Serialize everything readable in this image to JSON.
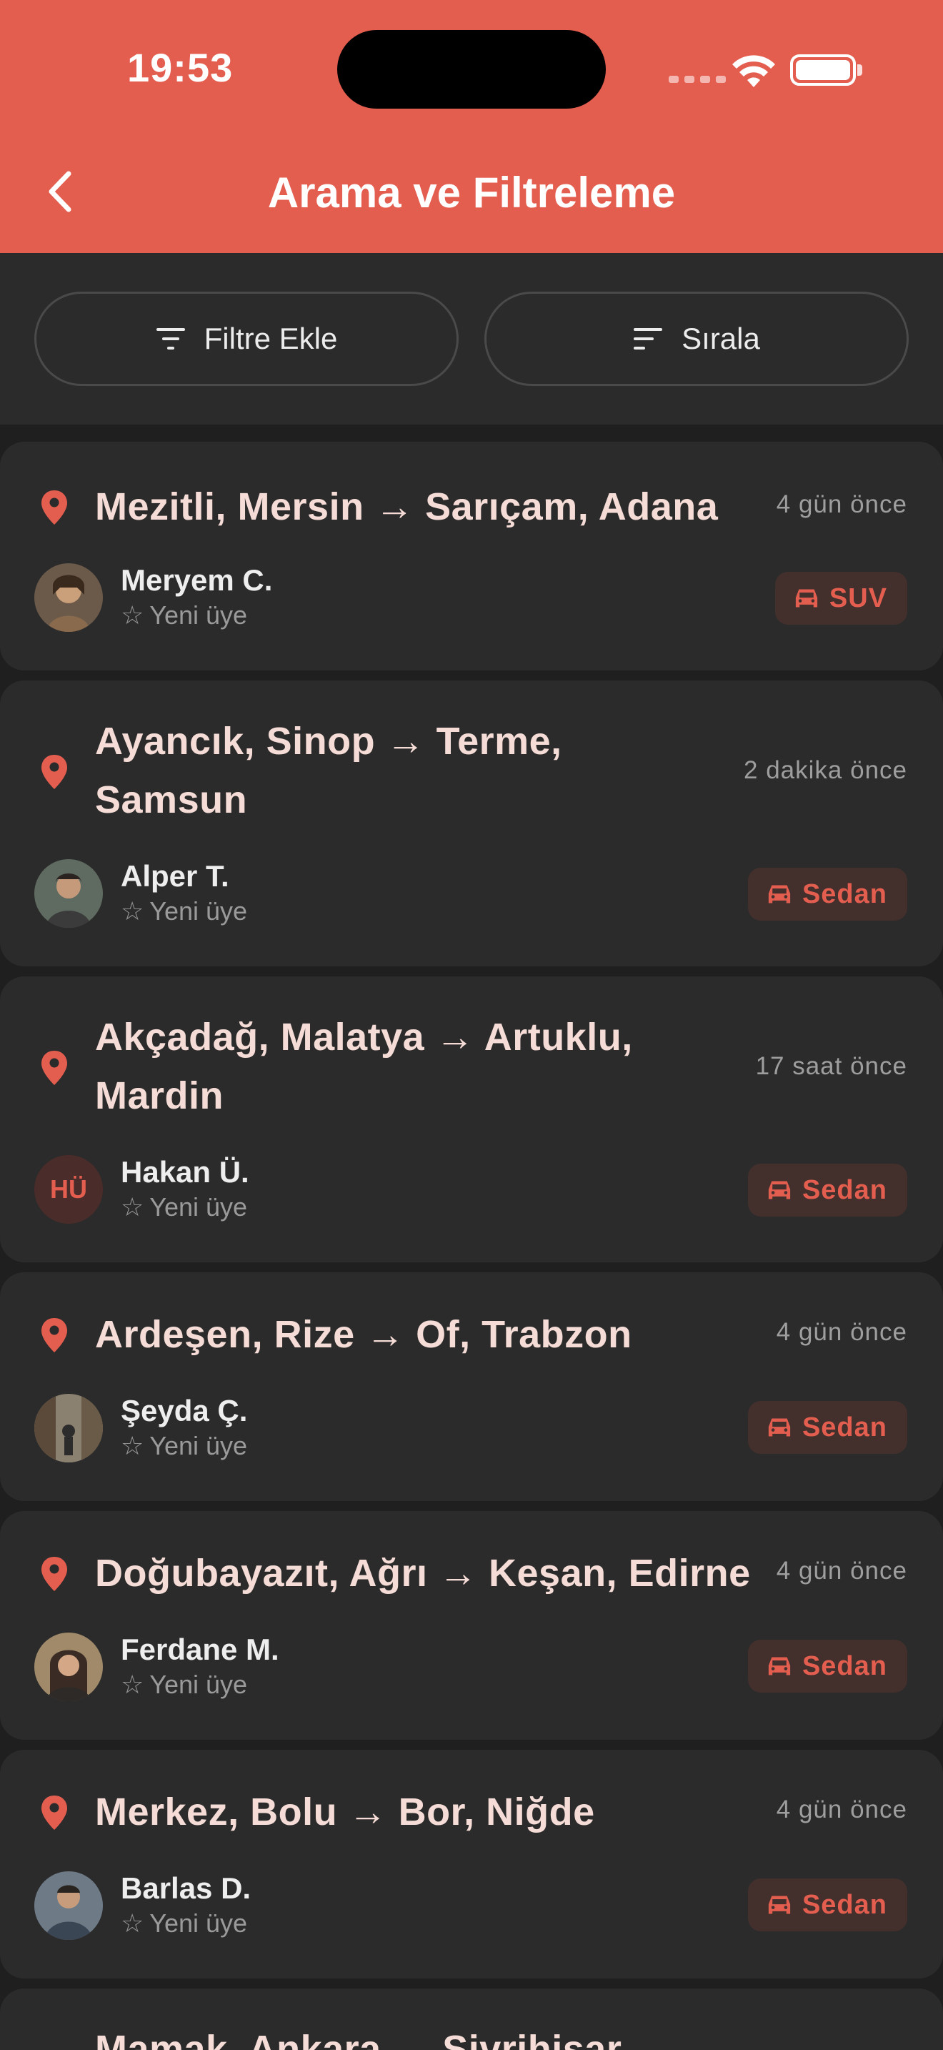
{
  "status_bar": {
    "time": "19:53"
  },
  "header": {
    "title": "Arama ve Filtreleme"
  },
  "toolbar": {
    "filter_label": "Filtre Ekle",
    "sort_label": "Sırala"
  },
  "theme": {
    "accent": "#e45e50",
    "card_bg": "#2b2b2b",
    "page_bg": "#1f1f1f"
  },
  "rides": [
    {
      "route": "Mezitli, Mersin → Sarıçam, Adana",
      "time": "4 gün önce",
      "user": "Meryem C.",
      "rating": "Yeni üye",
      "vehicle": "SUV",
      "avatar": "photo"
    },
    {
      "route": "Ayancık, Sinop → Terme, Samsun",
      "time": "2 dakika önce",
      "user": "Alper T.",
      "rating": "Yeni üye",
      "vehicle": "Sedan",
      "avatar": "photo"
    },
    {
      "route": "Akçadağ, Malatya → Artuklu, Mardin",
      "time": "17 saat önce",
      "user": "Hakan Ü.",
      "rating": "Yeni üye",
      "vehicle": "Sedan",
      "avatar_initials": "HÜ"
    },
    {
      "route": "Ardeşen, Rize → Of, Trabzon",
      "time": "4 gün önce",
      "user": "Şeyda Ç.",
      "rating": "Yeni üye",
      "vehicle": "Sedan",
      "avatar": "photo"
    },
    {
      "route": "Doğubayazıt, Ağrı → Keşan, Edirne",
      "time": "4 gün önce",
      "user": "Ferdane M.",
      "rating": "Yeni üye",
      "vehicle": "Sedan",
      "avatar": "photo"
    },
    {
      "route": "Merkez, Bolu → Bor, Niğde",
      "time": "4 gün önce",
      "user": "Barlas D.",
      "rating": "Yeni üye",
      "vehicle": "Sedan",
      "avatar": "photo"
    },
    {
      "route": "Mamak, Ankara → Sivrihisar"
    }
  ],
  "icons": {
    "back": "chevron-left-icon",
    "filter": "filter-icon",
    "sort": "sort-icon",
    "pin": "location-pin-icon",
    "car": "car-icon",
    "star": "star-outline-icon"
  }
}
